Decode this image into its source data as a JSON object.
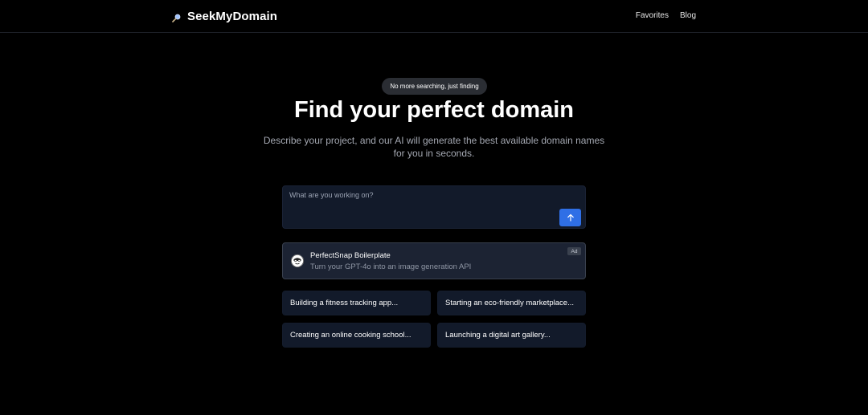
{
  "header": {
    "brand_name": "SeekMyDomain",
    "brand_icon": "magnifier-icon",
    "nav": [
      {
        "label": "Favorites"
      },
      {
        "label": "Blog"
      }
    ]
  },
  "hero": {
    "badge": "No more searching, just finding",
    "title": "Find your perfect domain",
    "subtitle": "Describe your project, and our AI will generate the best available domain names for you in seconds."
  },
  "prompt": {
    "placeholder": "What are you working on?",
    "value": "",
    "submit_icon": "arrow-up-icon"
  },
  "ad": {
    "title": "PerfectSnap Boilerplate",
    "description": "Turn your GPT-4o into an image generation API",
    "badge": "Ad",
    "logo_icon": "mascot-logo-icon"
  },
  "suggestions": [
    {
      "label": "Building a fitness tracking app..."
    },
    {
      "label": "Starting an eco-friendly marketplace..."
    },
    {
      "label": "Creating an online cooking school..."
    },
    {
      "label": "Launching a digital art gallery..."
    }
  ],
  "colors": {
    "background": "#000000",
    "accent": "#2f6fe6",
    "card": "#121a2a",
    "ad_card": "#1c2333"
  }
}
